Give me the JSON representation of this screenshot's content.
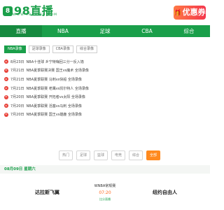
{
  "header": {
    "logo_badge": "8",
    "logo_text": "98直播",
    "logo_sub": "WWW.98ZHIBO.COM",
    "promo_label": "优惠券"
  },
  "nav": [
    {
      "label": "直播",
      "active": true
    },
    {
      "label": "NBA",
      "active": false
    },
    {
      "label": "足球",
      "active": false
    },
    {
      "label": "CBA",
      "active": false
    },
    {
      "label": "综合",
      "active": false
    }
  ],
  "subtabs": [
    {
      "label": "NBA录像",
      "active": true
    },
    {
      "label": "足球录像",
      "active": false
    },
    {
      "label": "CBA录像",
      "active": false
    },
    {
      "label": "综合录像",
      "active": false
    }
  ],
  "list": [
    {
      "date": "8月23日",
      "title": "NBA十佳球 乡宁特嗨回三分一反入墙"
    },
    {
      "date": "7月21日",
      "title": "NBA夏季联赛决赛 国王vs魔术 全场录像"
    },
    {
      "date": "7月21日",
      "title": "NBA夏季联赛 马刺vs快船 全场录像"
    },
    {
      "date": "7月21日",
      "title": "NBA夏季联赛 老鹰vs凯尔特人 全场录像"
    },
    {
      "date": "7月20日",
      "title": "NBA夏季联赛 开拓者vs太阳 全场录像"
    },
    {
      "date": "7月20日",
      "title": "NBA夏季联赛 活塞vs马刺 全场录像"
    },
    {
      "date": "7月20日",
      "title": "NBA夏季联赛 国王vs雄鹿 全场录像"
    }
  ],
  "filters": [
    {
      "label": "热门",
      "active": false
    },
    {
      "label": "足球",
      "active": false
    },
    {
      "label": "篮球",
      "active": false
    },
    {
      "label": "电竞",
      "active": false
    },
    {
      "label": "综合",
      "active": false
    },
    {
      "label": "全部",
      "active": true
    }
  ],
  "date_bar": "08月09日 星期六",
  "match": {
    "home": "达拉斯飞翼",
    "away": "纽约自由人",
    "league": "WNBA常规赛",
    "time": "07:20",
    "status": "比分直播"
  }
}
